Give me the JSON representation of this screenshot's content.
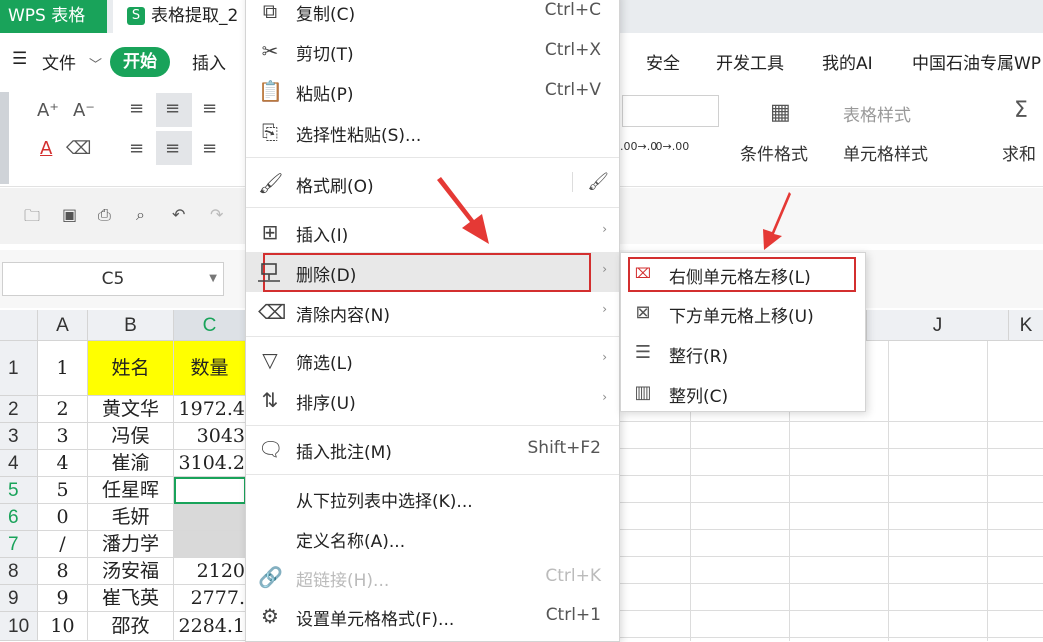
{
  "titlebar": {
    "app_name": "WPS 表格",
    "doc_icon": "S",
    "doc_tab": "表格提取_2"
  },
  "menubar": {
    "hamburger": "☰",
    "file": "文件",
    "file_chevron": "﹀",
    "start": "开始",
    "insert": "插入",
    "security": "安全",
    "devtools": "开发工具",
    "myai": "我的AI",
    "petro": "中国石油专属WP"
  },
  "ribbon": {
    "cond_format": "条件格式",
    "table_style": "表格样式",
    "cell_style": "单元格样式",
    "sum": "求和",
    "sum_icon": "Σ",
    "font_up": "A⁺",
    "font_down": "A⁻",
    "font_color": "A",
    "dec_up": ".00→.0",
    "dec_down": ".0→.00"
  },
  "namebox": {
    "value": "C5"
  },
  "columns": [
    "A",
    "B",
    "C",
    "J",
    "K"
  ],
  "rows": [
    {
      "num": "1",
      "a": "1",
      "b": "姓名",
      "c": "数量",
      "selected": false
    },
    {
      "num": "2",
      "a": "2",
      "b": "黄文华",
      "c": "1972.4",
      "selected": false
    },
    {
      "num": "3",
      "a": "3",
      "b": "冯俣",
      "c": "3043",
      "selected": false
    },
    {
      "num": "4",
      "a": "4",
      "b": "崔渝",
      "c": "3104.2",
      "selected": false
    },
    {
      "num": "5",
      "a": "5",
      "b": "任星晖",
      "c": "",
      "selected": true
    },
    {
      "num": "6",
      "a": "0",
      "b": "毛妍",
      "c": "",
      "selected": true
    },
    {
      "num": "7",
      "a": "/",
      "b": "潘力学",
      "c": "",
      "selected": true
    },
    {
      "num": "8",
      "a": "8",
      "b": "汤安福",
      "c": "2120",
      "selected": false
    },
    {
      "num": "9",
      "a": "9",
      "b": "崔飞英",
      "c": "2777.",
      "selected": false
    },
    {
      "num": "10",
      "a": "10",
      "b": "邵孜",
      "c": "2284.1",
      "selected": false
    }
  ],
  "context_menu": {
    "copy": {
      "label": "复制(C)",
      "shortcut": "Ctrl+C"
    },
    "cut": {
      "label": "剪切(T)",
      "shortcut": "Ctrl+X"
    },
    "paste": {
      "label": "粘贴(P)",
      "shortcut": "Ctrl+V"
    },
    "paste_special": {
      "label": "选择性粘贴(S)..."
    },
    "format_painter": {
      "label": "格式刷(O)"
    },
    "insert": {
      "label": "插入(I)"
    },
    "delete": {
      "label": "删除(D)"
    },
    "clear": {
      "label": "清除内容(N)"
    },
    "filter": {
      "label": "筛选(L)"
    },
    "sort": {
      "label": "排序(U)"
    },
    "comment": {
      "label": "插入批注(M)",
      "shortcut": "Shift+F2"
    },
    "pick_list": {
      "label": "从下拉列表中选择(K)..."
    },
    "define_name": {
      "label": "定义名称(A)..."
    },
    "hyperlink": {
      "label": "超链接(H)...",
      "shortcut": "Ctrl+K"
    },
    "format_cells": {
      "label": "设置单元格格式(F)...",
      "shortcut": "Ctrl+1"
    },
    "submenu_arrow": "›"
  },
  "delete_submenu": {
    "shift_left": "右侧单元格左移(L)",
    "shift_up": "下方单元格上移(U)",
    "entire_row": "整行(R)",
    "entire_col": "整列(C)"
  },
  "colors": {
    "accent": "#19a35a",
    "highlight": "#d32f2f",
    "yellow": "#ffff00"
  }
}
